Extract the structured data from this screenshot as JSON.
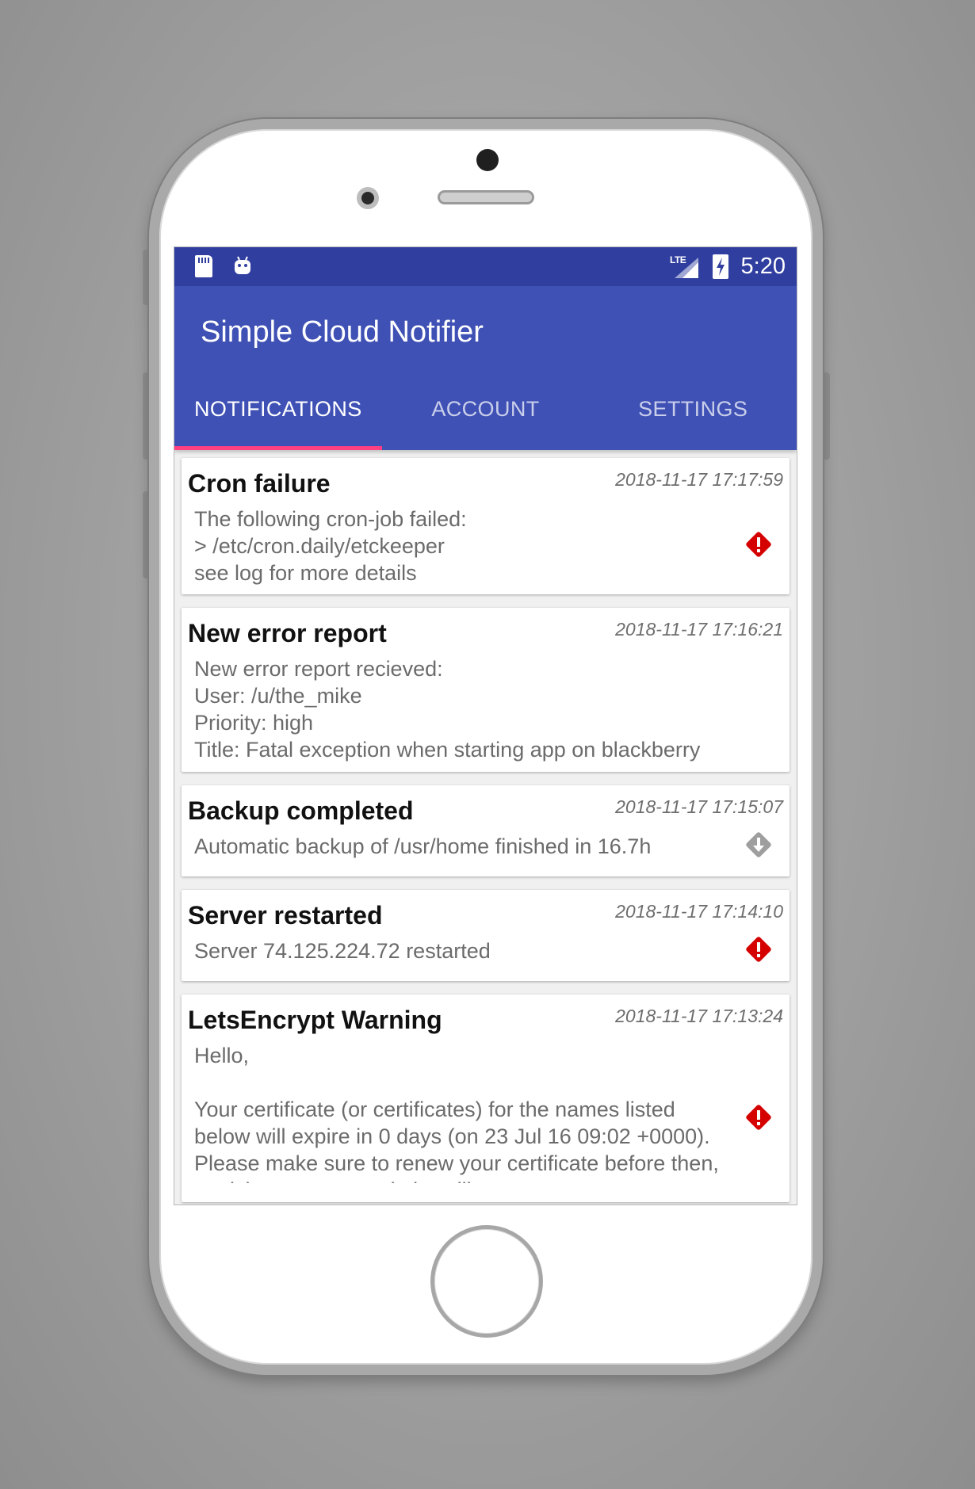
{
  "statusbar": {
    "time": "5:20",
    "network_label": "LTE",
    "left_icons": [
      "sd-card-icon",
      "android-debug-icon"
    ]
  },
  "app": {
    "title": "Simple Cloud Notifier"
  },
  "tabs": [
    {
      "label": "NOTIFICATIONS",
      "active": true
    },
    {
      "label": "ACCOUNT",
      "active": false
    },
    {
      "label": "SETTINGS",
      "active": false
    }
  ],
  "notifications": [
    {
      "title": "Cron failure",
      "timestamp": "2018-11-17 17:17:59",
      "body": "The following cron-job failed:\n>  /etc/cron.daily/etckeeper\nsee log for more details",
      "priority_icon": "error-red-icon"
    },
    {
      "title": "New error report",
      "timestamp": "2018-11-17 17:16:21",
      "body": "New error report recieved:\nUser: /u/the_mike\nPriority: high\nTitle: Fatal exception when starting app on blackberry",
      "priority_icon": ""
    },
    {
      "title": "Backup completed",
      "timestamp": "2018-11-17 17:15:07",
      "body": "Automatic backup of /usr/home finished in 16.7h",
      "priority_icon": "low-priority-grey-icon"
    },
    {
      "title": "Server restarted",
      "timestamp": "2018-11-17 17:14:10",
      "body": "Server 74.125.224.72 restarted",
      "priority_icon": "error-red-icon"
    },
    {
      "title": "LetsEncrypt Warning",
      "timestamp": "2018-11-17 17:13:24",
      "body": "Hello,\n\nYour certificate (or certificates) for the names listed below will expire in 0 days (on 23 Jul 16 09:02 +0000). Please make sure to renew your certificate before then, or visitors to your website will encounte...",
      "priority_icon": "error-red-icon"
    }
  ],
  "colors": {
    "statusbar": "#303f9f",
    "primary": "#3f51b5",
    "accent": "#ff4081",
    "error_icon": "#d50000",
    "low_icon": "#9e9e9e"
  }
}
